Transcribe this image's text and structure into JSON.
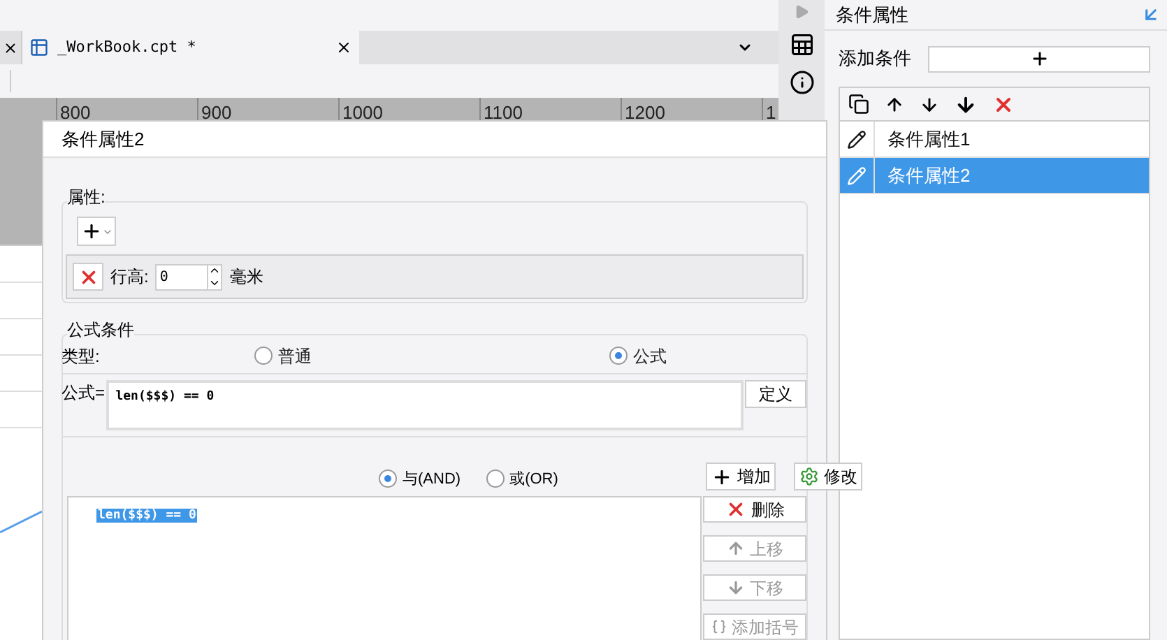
{
  "editor_tabs": [
    {
      "title": "_WorkBook.cpt *",
      "selected": true
    }
  ],
  "ruler": {
    "marks": [
      "800",
      "900",
      "1000",
      "1100",
      "1200",
      "1"
    ]
  },
  "side_panel": {
    "title": "条件属性",
    "add_label": "添加条件",
    "conditions": [
      {
        "name": "条件属性1",
        "selected": false
      },
      {
        "name": "条件属性2",
        "selected": true
      }
    ]
  },
  "dialog": {
    "title": "条件属性2",
    "properties": {
      "legend": "属性:",
      "row_height": {
        "label": "行高:",
        "value": "0",
        "unit": "毫米"
      }
    },
    "formula_condition": {
      "legend": "公式条件",
      "type_label": "类型:",
      "types": [
        {
          "label": "普通",
          "selected": false
        },
        {
          "label": "公式",
          "selected": true
        }
      ],
      "formula_label": "公式=",
      "formula": "len($$$) == 0",
      "define_button": "定义",
      "joins": [
        {
          "label": "与(AND)",
          "selected": true
        },
        {
          "label": "或(OR)",
          "selected": false
        }
      ],
      "actions": [
        {
          "label": "增加",
          "kind": "add"
        },
        {
          "label": "修改",
          "kind": "edit"
        }
      ],
      "conditions": [
        {
          "text": "len($$$) == 0",
          "selected": true
        }
      ],
      "side_buttons": [
        {
          "label": "删除",
          "kind": "delete",
          "disabled": false
        },
        {
          "label": "上移",
          "kind": "up",
          "disabled": true
        },
        {
          "label": "下移",
          "kind": "down",
          "disabled": true
        },
        {
          "label": "添加括号",
          "kind": "bracket",
          "disabled": true
        }
      ]
    }
  }
}
